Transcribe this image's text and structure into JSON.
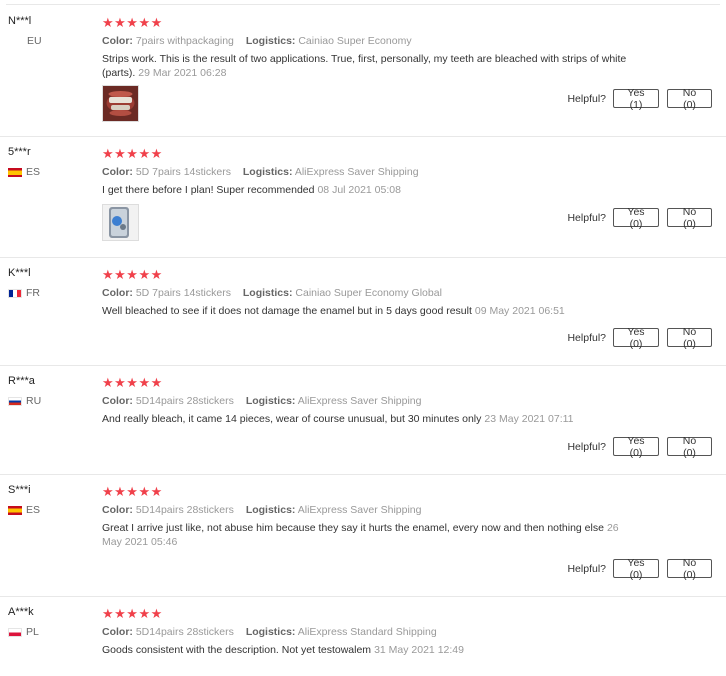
{
  "helpful_label": "Helpful?",
  "color_key": "Color:",
  "logistics_key": "Logistics:",
  "stars": "★★★★★",
  "reviews": [
    {
      "user": "N***l",
      "country": "EU",
      "flag": "none",
      "color": "7pairs withpackaging",
      "logistics": "Cainiao Super Economy",
      "text": "Strips work. This is the result of two applications. True, first, personally, my teeth are bleached with strips of white (parts).",
      "date": "29 Mar 2021 06:28",
      "yes": "Yes (1)",
      "no": "No (0)",
      "rating": 5
    },
    {
      "user": "5***r",
      "country": "ES",
      "flag": "es",
      "color": "5D 7pairs 14stickers",
      "logistics": "AliExpress Saver Shipping",
      "text": "I get there before I plan! Super recommended",
      "date": "08 Jul 2021 05:08",
      "yes": "Yes (0)",
      "no": "No (0)",
      "rating": 5
    },
    {
      "user": "K***l",
      "country": "FR",
      "flag": "fr",
      "color": "5D 7pairs 14stickers",
      "logistics": "Cainiao Super Economy Global",
      "text": "Well bleached to see if it does not damage the enamel but in 5 days good result",
      "date": "09 May 2021 06:51",
      "yes": "Yes (0)",
      "no": "No (0)",
      "rating": 5
    },
    {
      "user": "R***a",
      "country": "RU",
      "flag": "ru",
      "color": "5D14pairs 28stickers",
      "logistics": "AliExpress Saver Shipping",
      "text": "And really bleach, it came 14 pieces, wear of course unusual, but 30 minutes only",
      "date": "23 May 2021 07:11",
      "yes": "Yes (0)",
      "no": "No (0)",
      "rating": 5
    },
    {
      "user": "S***i",
      "country": "ES",
      "flag": "es",
      "color": "5D14pairs 28stickers",
      "logistics": "AliExpress Saver Shipping",
      "text": "Great I arrive just like, not abuse him because they say it hurts the enamel, every now and then nothing else",
      "date": "26 May 2021 05:46",
      "yes": "Yes (0)",
      "no": "No (0)",
      "rating": 5
    },
    {
      "user": "A***k",
      "country": "PL",
      "flag": "pl",
      "color": "5D14pairs 28stickers",
      "logistics": "AliExpress Standard Shipping",
      "text": "Goods consistent with the description. Not yet testowalem",
      "date": "31 May 2021 12:49",
      "yes": "",
      "no": "",
      "rating": 5
    }
  ]
}
